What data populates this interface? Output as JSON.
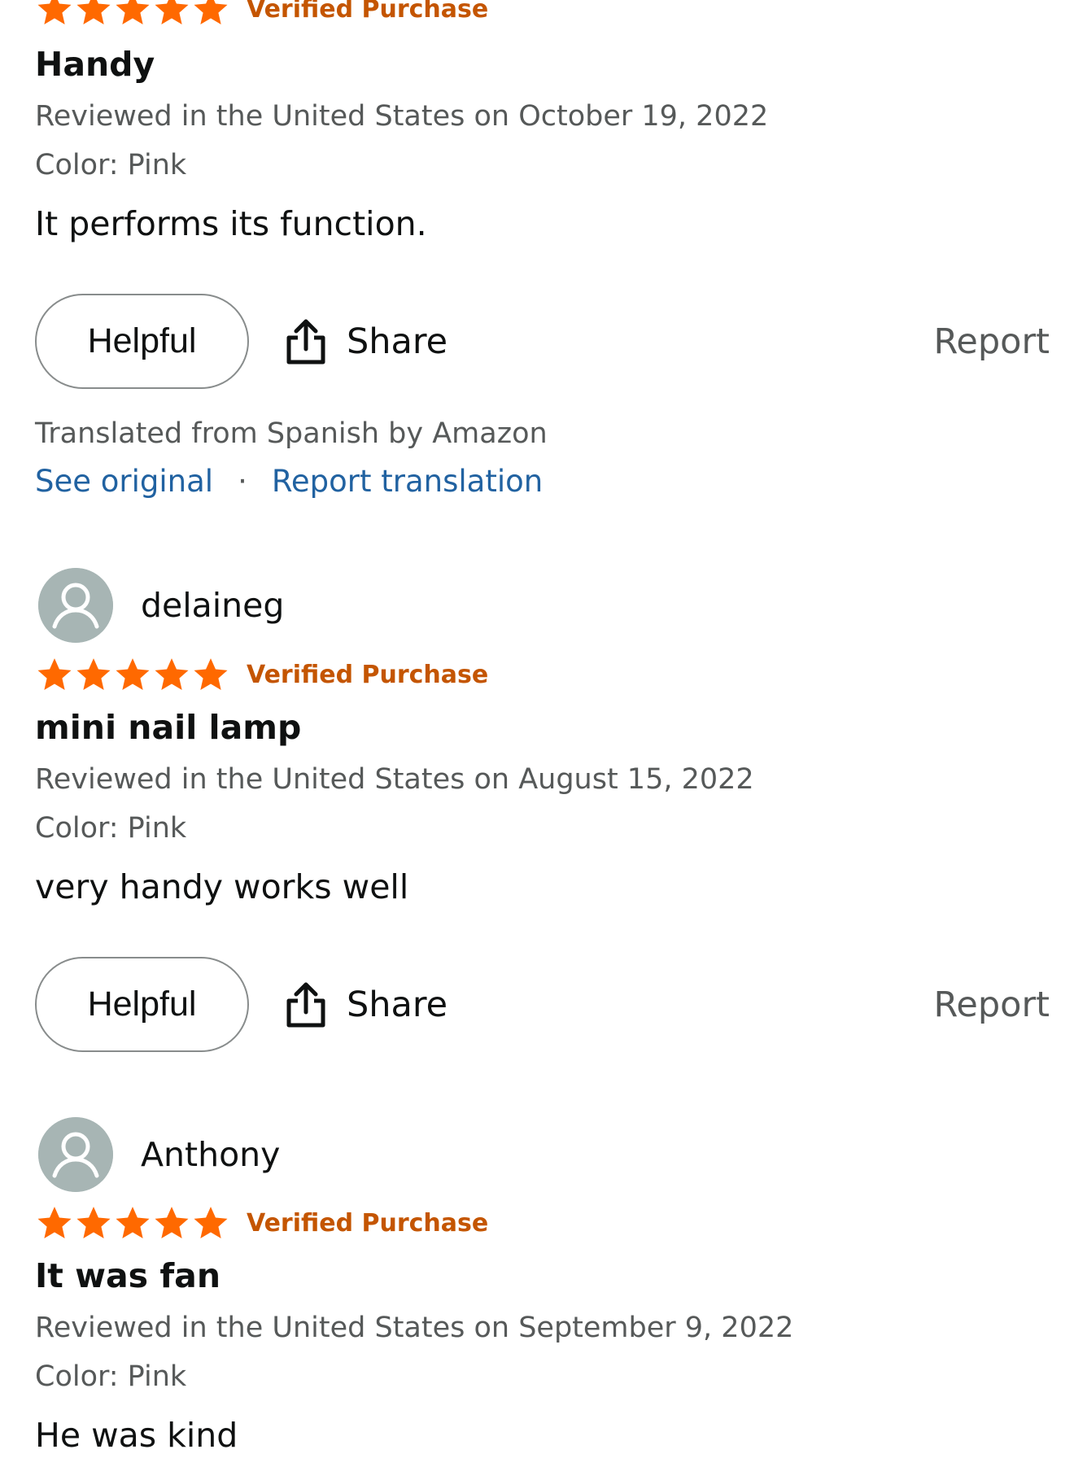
{
  "colors": {
    "star": "#ff6900",
    "verified": "#c45500",
    "link": "#2162a1",
    "meta": "#565959",
    "avatar_bg": "#a7b5b4"
  },
  "icons": {
    "star": "star-icon",
    "share": "share-icon",
    "avatar": "user-avatar-icon"
  },
  "reviews": [
    {
      "rating": 5,
      "verified_label": "Verified Purchase",
      "title": "Handy",
      "review_date": "Reviewed in the United States on October 19, 2022",
      "color": "Color: Pink",
      "body": "It performs its function.",
      "helpful_label": "Helpful",
      "share_label": "Share",
      "report_label": "Report",
      "translation_note": "Translated from Spanish by Amazon",
      "see_original_label": "See original",
      "separator": "·",
      "report_translation_label": "Report translation"
    },
    {
      "reviewer": "delaineg",
      "rating": 5,
      "verified_label": "Verified Purchase",
      "title": "mini nail lamp",
      "review_date": "Reviewed in the United States on August 15, 2022",
      "color": "Color: Pink",
      "body": "very handy works well",
      "helpful_label": "Helpful",
      "share_label": "Share",
      "report_label": "Report"
    },
    {
      "reviewer": "Anthony",
      "rating": 5,
      "verified_label": "Verified Purchase",
      "title": "It was fan",
      "review_date": "Reviewed in the United States on September 9, 2022",
      "color": "Color: Pink",
      "body": "He was kind"
    }
  ]
}
